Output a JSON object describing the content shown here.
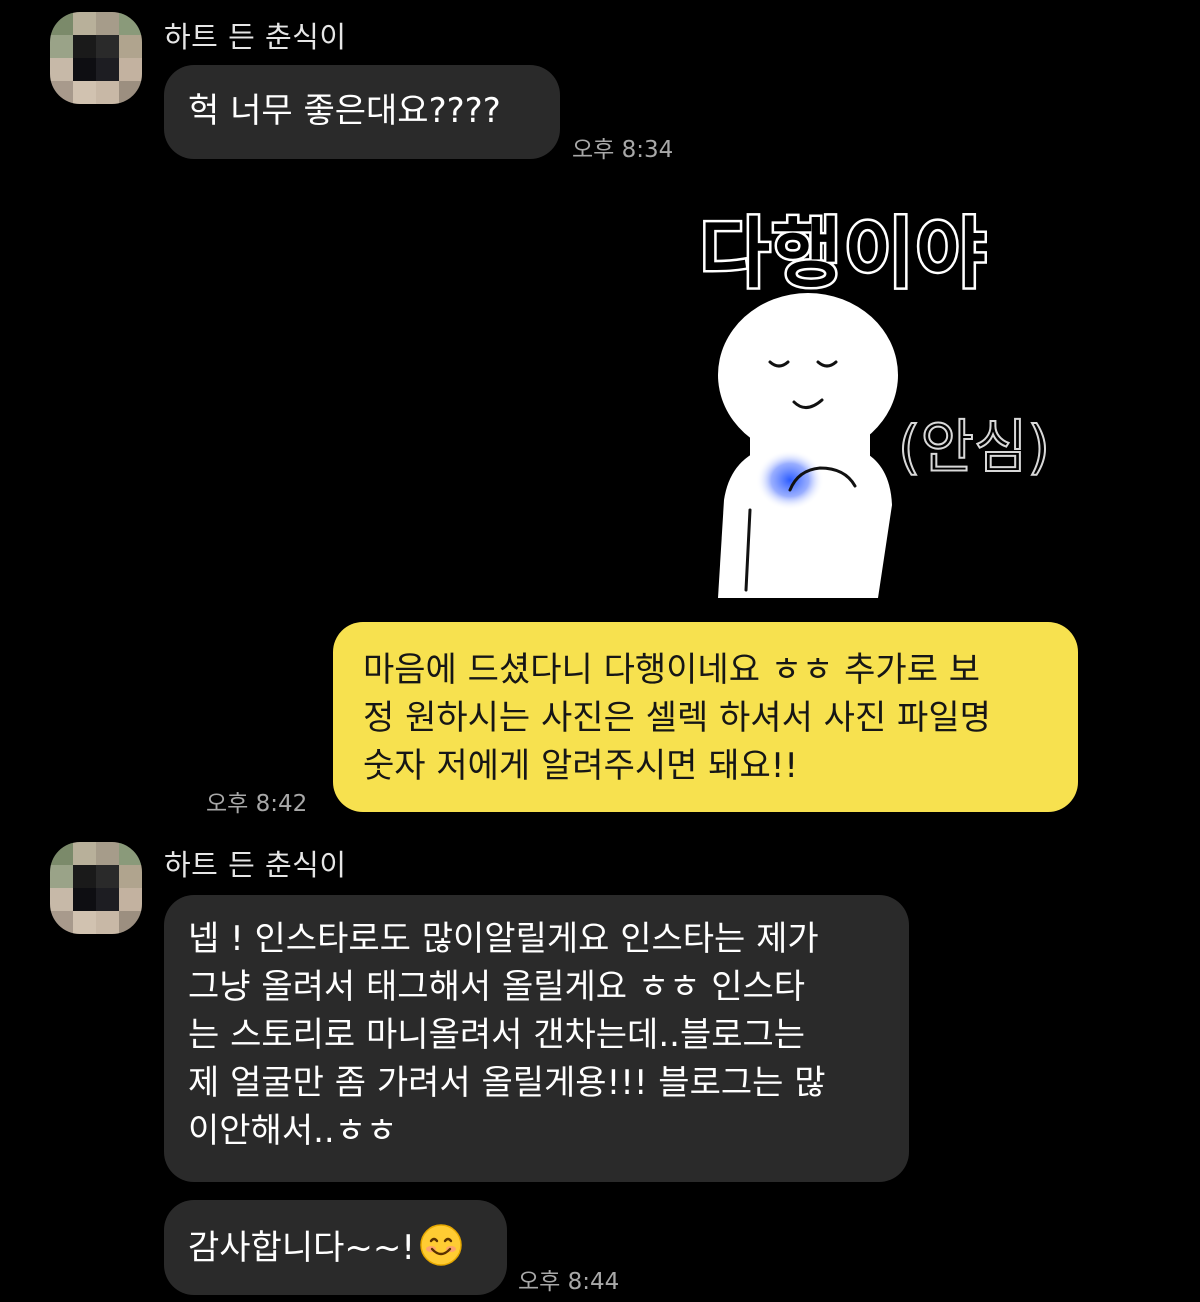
{
  "chat": {
    "contact_name": "하트 든 춘식이",
    "messages": [
      {
        "sender": "하트 든 춘식이",
        "lines": [
          "헉 너무 좋은대요????"
        ],
        "time": "오후 8:34"
      },
      {
        "sticker": {
          "title": "다행이야",
          "note": "(안심)",
          "character_icon": "relieved-character-icon"
        }
      },
      {
        "lines": [
          "마음에 드셨다니 다행이네요 ㅎㅎ 추가로 보",
          "정 원하시는 사진은 셀렉 하셔서 사진 파일명",
          "숫자 저에게 알려주시면 돼요!!"
        ],
        "time": "오후 8:42"
      },
      {
        "sender": "하트 든 춘식이",
        "lines": [
          "넵 ! 인스타로도 많이알릴게요 인스타는 제가",
          "그냥 올려서 태그해서 올릴게요 ㅎㅎ 인스타",
          "는 스토리로 마니올려서 갠차는데..블로그는",
          "제 얼굴만 좀 가려서 올릴게용!!! 블로그는 많",
          "이안해서..ㅎㅎ"
        ]
      },
      {
        "lines": [
          "감사합니다~~!"
        ],
        "emoji": "smiling-face-icon",
        "time": "오후 8:44"
      }
    ]
  },
  "colors": {
    "background": "#000000",
    "incoming_bubble": "#2a2a2a",
    "outgoing_bubble": "#f7e14f",
    "timestamp": "#a8a8a8"
  }
}
